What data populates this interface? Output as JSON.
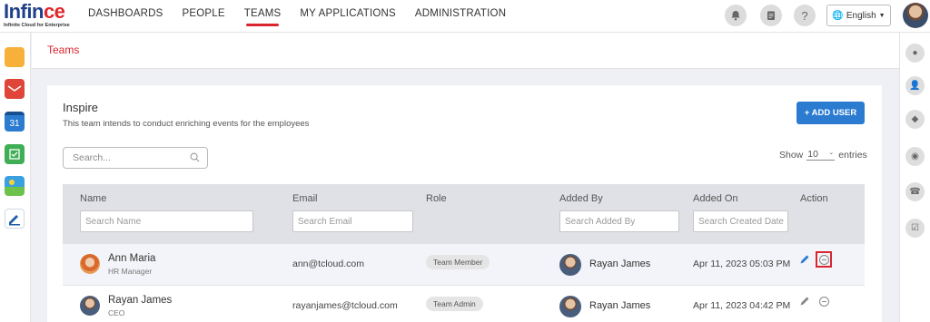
{
  "logo": {
    "text_main": "Infin",
    "text_accent": "ce",
    "tagline": "Infinite Cloud for Enterprise"
  },
  "nav": {
    "items": [
      {
        "label": "DASHBOARDS"
      },
      {
        "label": "PEOPLE"
      },
      {
        "label": "TEAMS",
        "active": true
      },
      {
        "label": "MY APPLICATIONS"
      },
      {
        "label": "ADMINISTRATION"
      }
    ]
  },
  "header": {
    "language": "English",
    "icons": [
      "bell-icon",
      "clipboard-icon",
      "help-icon"
    ]
  },
  "left_apps": [
    {
      "name": "folder-app-icon",
      "color": "#f7b13a"
    },
    {
      "name": "mail-app-icon",
      "color": "#e0453a"
    },
    {
      "name": "calendar-app-icon",
      "color": "#2b7bd0",
      "label": "31"
    },
    {
      "name": "notes-app-icon",
      "color": "#3fae55"
    },
    {
      "name": "photos-app-icon",
      "color": "#3aa0e0"
    },
    {
      "name": "edit-app-icon",
      "color": "#1e5fa8"
    }
  ],
  "right_icons": [
    "chat-icon",
    "person-icon",
    "contacts-icon",
    "group-icon",
    "phone-icon",
    "tasks-icon"
  ],
  "breadcrumb": {
    "current": "Teams"
  },
  "team": {
    "name": "Inspire",
    "description": "This team intends to conduct enriching events for the employees",
    "add_user_label": "+ ADD USER"
  },
  "search": {
    "placeholder": "Search..."
  },
  "entries": {
    "show_label": "Show",
    "value": "10",
    "suffix": "entries"
  },
  "table": {
    "columns": {
      "name": "Name",
      "email": "Email",
      "role": "Role",
      "added_by": "Added By",
      "added_on": "Added On",
      "action": "Action"
    },
    "filters": {
      "name": "Search Name",
      "email": "Search Email",
      "added_by": "Search Added By",
      "added_on": "Search Created Date"
    },
    "rows": [
      {
        "name": "Ann Maria",
        "title": "HR Manager",
        "email": "ann@tcloud.com",
        "role": "Team Member",
        "added_by": "Rayan James",
        "added_on": "Apr 11, 2023 05:03 PM"
      },
      {
        "name": "Rayan James",
        "title": "CEO",
        "email": "rayanjames@tcloud.com",
        "role": "Team Admin",
        "added_by": "Rayan James",
        "added_on": "Apr 11, 2023 04:42 PM"
      }
    ]
  },
  "colors": {
    "brand_red": "#d9262e",
    "primary_blue": "#2b7bd0",
    "header_gray": "#dfe1e6"
  }
}
